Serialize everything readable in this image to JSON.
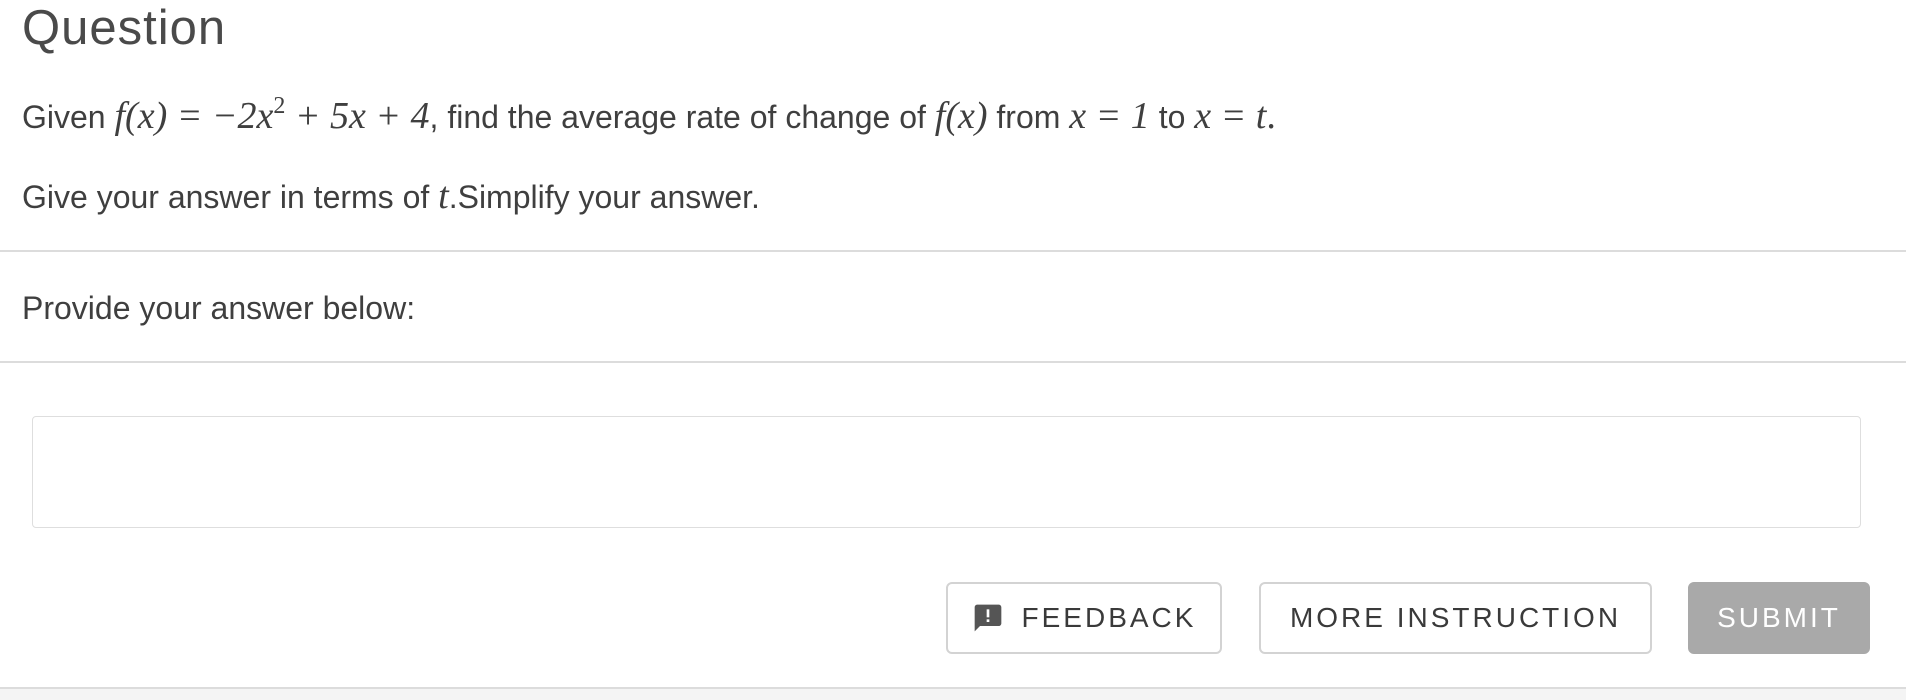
{
  "header": {
    "title": "Question"
  },
  "question": {
    "line1": {
      "given": "Given",
      "fx": "f(x) = −2x",
      "exponent": "2",
      "rest_of_function": " + 5x + 4",
      "find_text": ", find the average rate of change of",
      "fx2": "f(x)",
      "from_text": "from",
      "x_equals_1": "x = 1",
      "to_text": "to",
      "x_equals_t": "x = t",
      "period": "."
    },
    "line2": {
      "give_text": "Give your answer in terms of",
      "var": "t",
      "simplify_text": ".Simplify your answer."
    }
  },
  "answer": {
    "prompt": "Provide your answer below:",
    "value": "",
    "placeholder": ""
  },
  "buttons": {
    "feedback": "FEEDBACK",
    "more_instruction": "MORE INSTRUCTION",
    "submit": "SUBMIT"
  },
  "icons": {
    "feedback": "feedback-icon"
  },
  "colors": {
    "submit_bg": "#a9a9a9",
    "text": "#3f3f3f",
    "divider": "#dcdcdc"
  }
}
